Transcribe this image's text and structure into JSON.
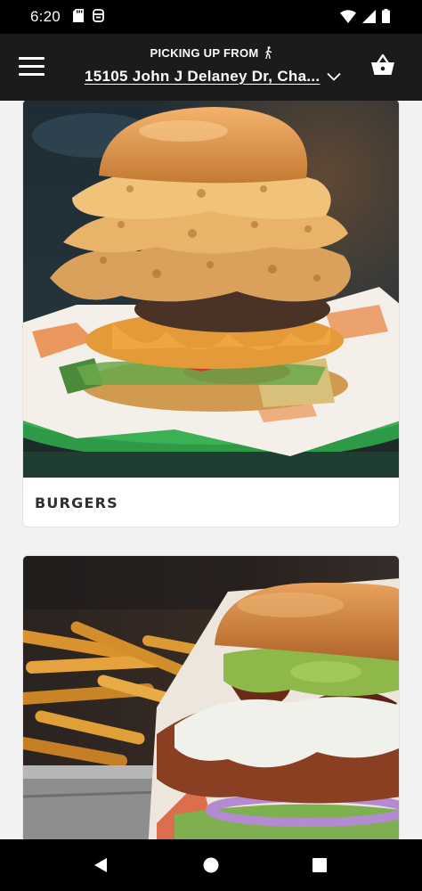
{
  "status_bar": {
    "time": "6:20",
    "icons": [
      "sd-card-icon",
      "mail-icon",
      "wifi-icon",
      "signal-icon",
      "battery-icon"
    ]
  },
  "header": {
    "pickup_label": "PICKING UP FROM",
    "location": "15105 John J Delaney Dr, Cha...",
    "icons": [
      "menu-icon",
      "walking-person-icon",
      "chevron-down-icon",
      "basket-icon"
    ]
  },
  "categories": [
    {
      "title": "BURGERS",
      "image": "tall-fried-onion-double-cheeseburger-photo"
    },
    {
      "title": "",
      "image": "guacamole-bacon-burger-with-fries-photo"
    }
  ],
  "nav_bar": {
    "icons": [
      "back-icon",
      "home-icon",
      "recents-icon"
    ]
  },
  "colors": {
    "header_bg": "#1b1b1b",
    "status_bg": "#000000",
    "page_bg": "#f2f2f2",
    "card_bg": "#ffffff",
    "title_text": "#2f2f2f"
  }
}
